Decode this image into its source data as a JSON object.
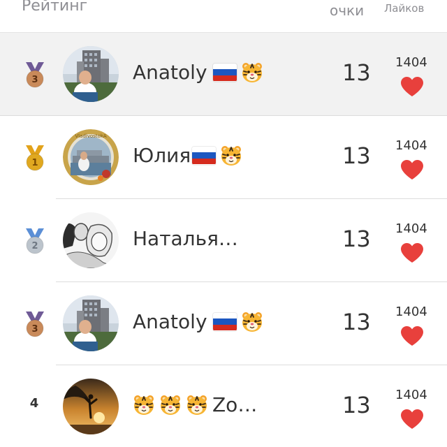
{
  "header": {
    "rating_label": "Рейтинг",
    "points_label": "очки",
    "likes_label": "Лайков"
  },
  "colors": {
    "heart": "#e8403c",
    "medal_gold": "#e0a820",
    "medal_silver": "#bcc4cc",
    "medal_bronze": "#c98a5a",
    "ribbon_bronze": "#6f5a96",
    "ribbon_gold": "#e2a21a",
    "ribbon_silver": "#5b8fd6"
  },
  "rows": [
    {
      "rank": "3",
      "medal": "bronze",
      "name": "Anatoly",
      "flag": true,
      "tigers": 1,
      "points": "13",
      "likes": "1404",
      "highlight": true,
      "avatar_icon": "building-photo-avatar"
    },
    {
      "rank": "1",
      "medal": "gold",
      "name": "Юлия",
      "flag": true,
      "tigers": 1,
      "points": "13",
      "likes": "1404",
      "highlight": false,
      "avatar_icon": "framed-photo-avatar"
    },
    {
      "rank": "2",
      "medal": "silver",
      "name": "Наталья…",
      "flag": false,
      "tigers": 0,
      "points": "13",
      "likes": "1404",
      "highlight": false,
      "avatar_icon": "sketch-photo-avatar"
    },
    {
      "rank": "3",
      "medal": "bronze",
      "name": "Anatoly",
      "flag": true,
      "tigers": 1,
      "points": "13",
      "likes": "1404",
      "highlight": false,
      "avatar_icon": "building-photo-avatar"
    },
    {
      "rank": "4",
      "medal": "none",
      "name": "Zo…",
      "flag": false,
      "tigers": 3,
      "points": "13",
      "likes": "1404",
      "highlight": false,
      "avatar_icon": "sunset-photo-avatar"
    }
  ]
}
